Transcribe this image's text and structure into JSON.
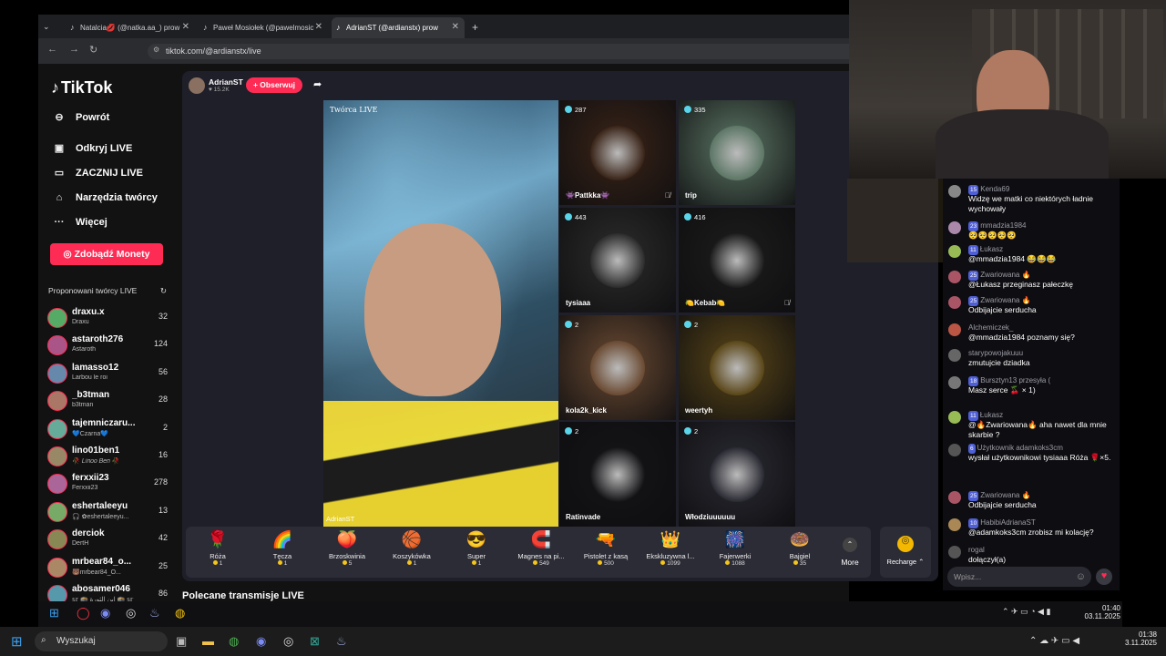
{
  "browser": {
    "tabs": [
      {
        "title": "Natalcia💋 (@natka.aa_) prow",
        "active": false
      },
      {
        "title": "Paweł Mosiołek (@pawelmosic",
        "active": false
      },
      {
        "title": "AdrianST (@ardianstx) prow",
        "active": true
      }
    ],
    "url": "tiktok.com/@ardianstx/live"
  },
  "sidebar": {
    "logo": "TikTok",
    "nav": [
      {
        "label": "Powrót",
        "icon": "back-arrow-icon"
      },
      {
        "label": "Odkryj LIVE",
        "icon": "tv-icon"
      },
      {
        "label": "ZACZNIJ LIVE",
        "icon": "camera-icon"
      },
      {
        "label": "Narzędzia twórcy",
        "icon": "home-icon"
      },
      {
        "label": "Więcej",
        "icon": "more-icon"
      }
    ],
    "coins_button": "Zdobądź Monety",
    "suggested_title": "Proponowani twórcy LIVE",
    "creators": [
      {
        "name": "draxu.x",
        "sub": "Draxu",
        "count": "32"
      },
      {
        "name": "astaroth276",
        "sub": "Astaroth",
        "count": "124"
      },
      {
        "name": "lamasso12",
        "sub": "Larbou le roi",
        "count": "56"
      },
      {
        "name": "_b3tman",
        "sub": "b3tman",
        "count": "28"
      },
      {
        "name": "tajemniczaru...",
        "sub": "💙Czarna💙",
        "count": "2"
      },
      {
        "name": "lino01ben1",
        "sub": "🥀 𝐿𝑖𝑛𝑜𝑜 𝐵𝑒𝑛 🥀",
        "count": "16"
      },
      {
        "name": "ferxxii23",
        "sub": "Ferxxii23",
        "count": "278"
      },
      {
        "name": "eshertaleeyu",
        "sub": "🎧 ✿eshertaleeyu...",
        "count": "13"
      },
      {
        "name": "derciok",
        "sub": "DertH",
        "count": "42"
      },
      {
        "name": "mrbear84_o...",
        "sub": "🐻mrbear84_O...",
        "count": "25"
      },
      {
        "name": "abosamer046",
        "sub": "𝕤𝕣 🕋 ابن الثورة 🕋 𝕤𝕣",
        "count": "86"
      }
    ]
  },
  "live": {
    "host_name": "AdrianST",
    "host_followers": "15.2K",
    "follow_button": "+ Obserwuj",
    "host_label": "Twórca LIVE",
    "host_caption": "AdrianST",
    "guests": [
      {
        "name": "👾Pattkka👾",
        "viewers": "287",
        "muted": true,
        "color": "#3a2418"
      },
      {
        "name": "trip",
        "viewers": "335",
        "muted": false,
        "color": "#5d7766"
      },
      {
        "name": "tysiaaa",
        "viewers": "443",
        "muted": false,
        "color": "#2c2c2c"
      },
      {
        "name": "🍋Kebab🍋",
        "viewers": "416",
        "muted": true,
        "color": "#1d1d1d"
      },
      {
        "name": "kola2k_kick",
        "viewers": "2",
        "muted": false,
        "color": "#6a4a32"
      },
      {
        "name": "weertyh",
        "viewers": "2",
        "muted": false,
        "color": "#5a4618"
      },
      {
        "name": "Ratinvade",
        "viewers": "2",
        "muted": false,
        "color": "#151518"
      },
      {
        "name": "Włodziuuuuuu",
        "viewers": "2",
        "muted": false,
        "color": "#2a2a33"
      }
    ],
    "recommended_title": "Polecane transmisje LIVE"
  },
  "gifts": [
    {
      "icon": "🌹",
      "name": "Róża",
      "price": "1"
    },
    {
      "icon": "🌈",
      "name": "Tęcza",
      "price": "1"
    },
    {
      "icon": "🍑",
      "name": "Brzoskwinia",
      "price": "5"
    },
    {
      "icon": "🏀",
      "name": "Koszykówka",
      "price": "1"
    },
    {
      "icon": "😎",
      "name": "Super",
      "price": "1"
    },
    {
      "icon": "🧲",
      "name": "Magnes na pi...",
      "price": "549"
    },
    {
      "icon": "🔫",
      "name": "Pistolet z kasą",
      "price": "500"
    },
    {
      "icon": "👑",
      "name": "Ekskluzywna l...",
      "price": "1099"
    },
    {
      "icon": "🎆",
      "name": "Fajerwerki",
      "price": "1088"
    },
    {
      "icon": "🍩",
      "name": "Bajgiel",
      "price": "35"
    }
  ],
  "gift_more": "More",
  "recharge": "Recharge",
  "chat": {
    "messages": [
      {
        "level": "15",
        "user": "Kenda69",
        "text": "Widzę we matki co niektórych ładnie wychowały"
      },
      {
        "level": "23",
        "user": "mmadzia1984",
        "text": "🥺🥺🥺🥺🥺"
      },
      {
        "level": "11",
        "user": "Łukasz",
        "text": "@mmadzia1984 😂😂😂"
      },
      {
        "level": "25",
        "user": "Zwariowana 🔥",
        "text": "@Łukasz przeginasz pałeczkę"
      },
      {
        "level": "25",
        "user": "Zwariowana 🔥",
        "text": "Odbijajcie serducha"
      },
      {
        "level": "",
        "user": "Alchemiczek_",
        "text": "@mmadzia1984 poznamy się?"
      },
      {
        "level": "",
        "user": "starypowojakuuu",
        "text": "zmutujcie dziadka"
      },
      {
        "level": "18",
        "user": "Bursztyn13 przesyła (",
        "text": "Masz serce 🍒 × 1)"
      },
      {
        "level": "11",
        "user": "Łukasz",
        "text": "@🔥Zwariowana🔥 aha nawet dla mnie skarbie ?"
      },
      {
        "level": "6",
        "user": "Użytkownik adamkoks3cm",
        "text": "wysłał użytkownikowi tysiaaa Róża 🌹×5."
      },
      {
        "level": "25",
        "user": "Zwariowana 🔥",
        "text": "Odbijajcie serducha"
      },
      {
        "level": "10",
        "user": "HabibiAdrianaST",
        "text": "@adamkoks3cm zrobisz mi kolację?"
      },
      {
        "level": "",
        "user": "rogal",
        "text": "dołączył(a)"
      }
    ],
    "input_placeholder": "Wpisz..."
  },
  "tray": {
    "time": "01:40",
    "date": "03.11.2025"
  },
  "taskbar": {
    "search": "Wyszukaj",
    "time": "01:38",
    "date": "3.11.2025"
  }
}
